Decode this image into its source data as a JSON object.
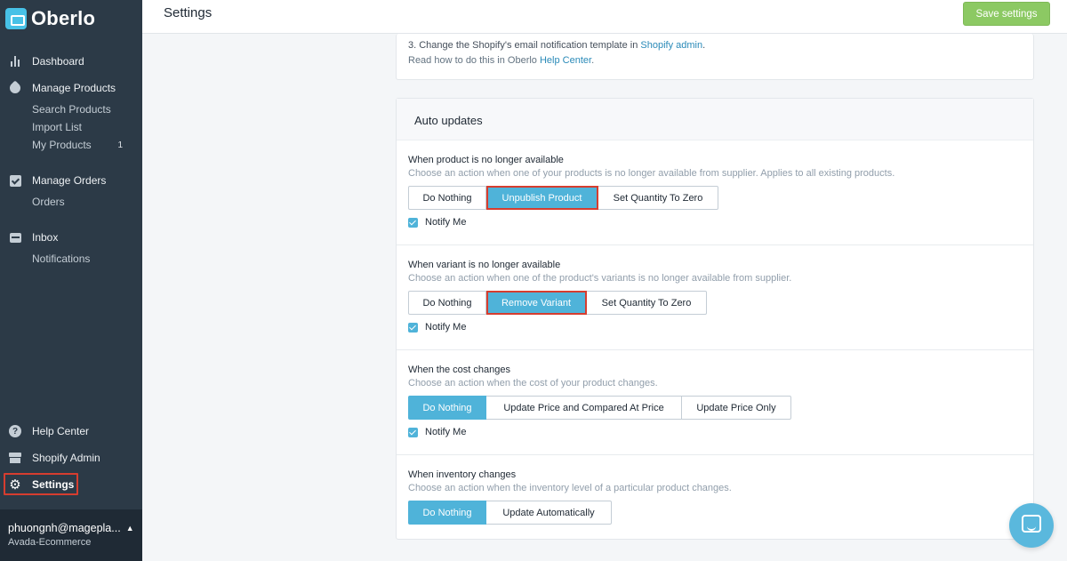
{
  "brand": {
    "name": "Oberlo",
    "accent": "#47c1e7",
    "sidebar_bg": "#2c3a47"
  },
  "sidebar": {
    "dashboard": "Dashboard",
    "manage_products": "Manage Products",
    "search_products": "Search Products",
    "import_list": "Import List",
    "my_products": "My Products",
    "my_products_count": "1",
    "manage_orders": "Manage Orders",
    "orders": "Orders",
    "inbox": "Inbox",
    "notifications": "Notifications",
    "help_center": "Help Center",
    "shopify_admin": "Shopify Admin",
    "settings": "Settings",
    "icons": [
      "bar-chart-icon",
      "tag-icon",
      "checkbox-icon",
      "inbox-icon",
      "help-icon",
      "store-icon",
      "gear-icon"
    ]
  },
  "account": {
    "email": "phuongnh@magepla...",
    "store": "Avada-Ecommerce"
  },
  "header": {
    "title": "Settings",
    "save_label": "Save settings",
    "save_color": "#8cc963"
  },
  "email_card": {
    "step_text": "3. Change the Shopify's email notification template in",
    "step_link": "Shopify admin",
    "step_end": ".",
    "read_text": "Read how to do this in Oberlo",
    "read_link": "Help Center",
    "read_end": "."
  },
  "auto_updates": {
    "heading": "Auto updates",
    "notify_label": "Notify Me",
    "sections": [
      {
        "title": "When product is no longer available",
        "desc": "Choose an action when one of your products is no longer available from supplier. Applies to all existing products.",
        "options": [
          "Do Nothing",
          "Unpublish Product",
          "Set Quantity To Zero"
        ],
        "selected": "Unpublish Product"
      },
      {
        "title": "When variant is no longer available",
        "desc": "Choose an action when one of the product's variants is no longer available from supplier.",
        "options": [
          "Do Nothing",
          "Remove Variant",
          "Set Quantity To Zero"
        ],
        "selected": "Remove Variant"
      },
      {
        "title": "When the cost changes",
        "desc": "Choose an action when the cost of your product changes.",
        "options": [
          "Do Nothing",
          "Update Price and Compared At Price",
          "Update Price Only"
        ],
        "selected": "Do Nothing"
      },
      {
        "title": "When inventory changes",
        "desc": "Choose an action when the inventory level of a particular product changes.",
        "options": [
          "Do Nothing",
          "Update Automatically"
        ],
        "selected": "Do Nothing"
      }
    ]
  },
  "selected_color": "#4fb3d9",
  "highlight_color": "#d63d2f",
  "chat": {
    "icon": "chat-icon"
  }
}
